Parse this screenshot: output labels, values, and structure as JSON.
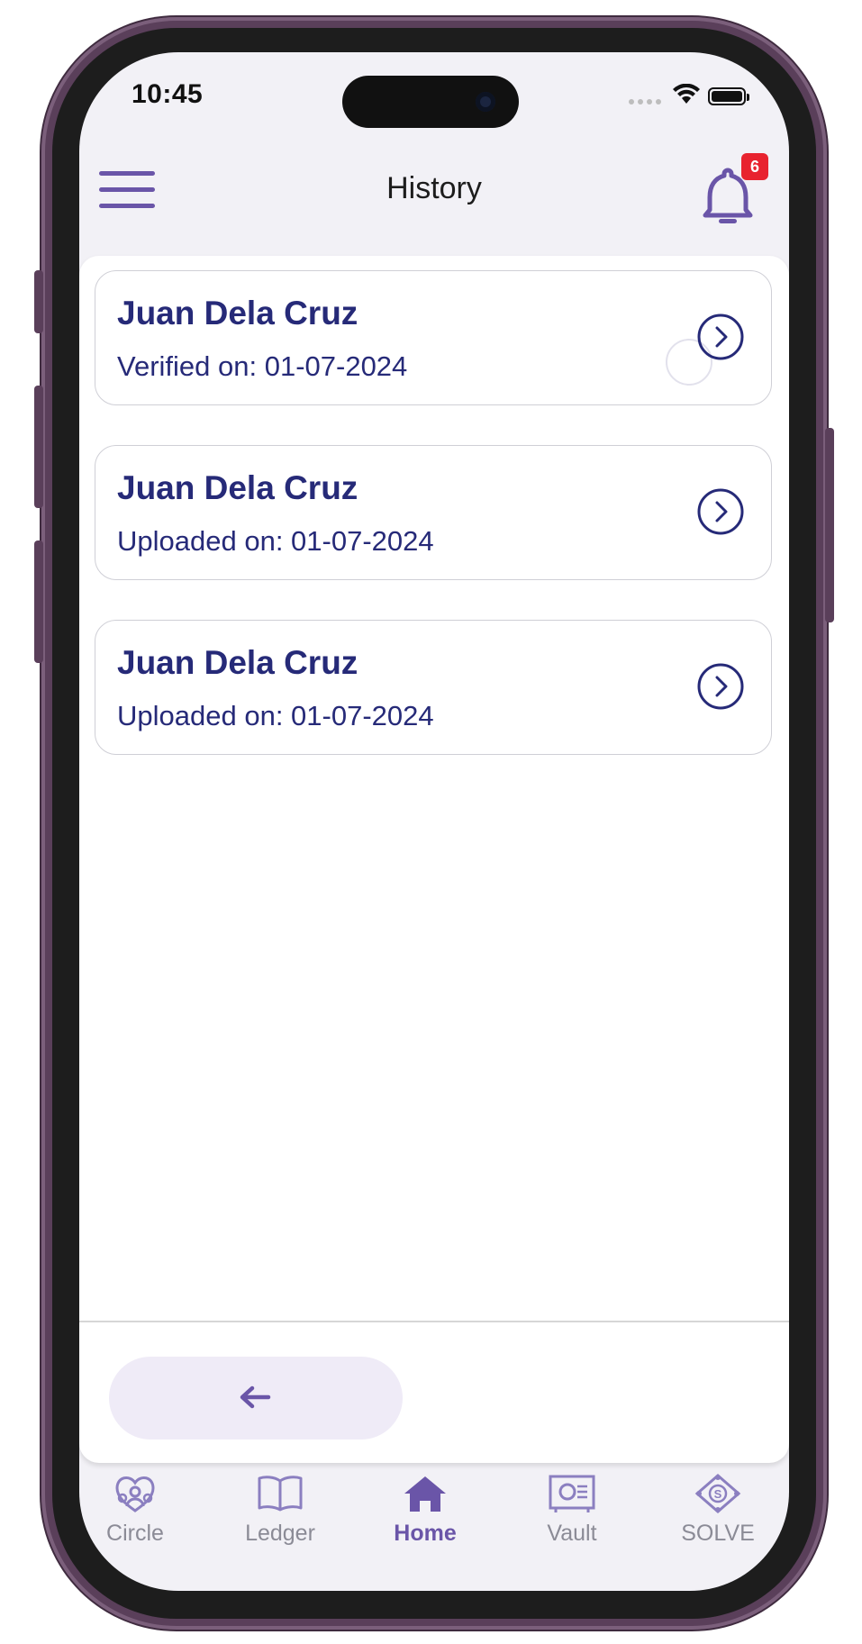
{
  "status_bar": {
    "time": "10:45"
  },
  "header": {
    "title": "History",
    "notification_count": "6"
  },
  "history_items": [
    {
      "name": "Juan Dela Cruz",
      "status": "Verified on: 01-07-2024"
    },
    {
      "name": "Juan Dela Cruz",
      "status": "Uploaded on: 01-07-2024"
    },
    {
      "name": "Juan Dela Cruz",
      "status": "Uploaded on: 01-07-2024"
    }
  ],
  "bottom_nav": {
    "active": "Home",
    "tabs": [
      {
        "label": "Circle",
        "icon": "circle-people-icon"
      },
      {
        "label": "Ledger",
        "icon": "book-icon"
      },
      {
        "label": "Home",
        "icon": "home-icon"
      },
      {
        "label": "Vault",
        "icon": "vault-icon"
      },
      {
        "label": "SOLVE",
        "icon": "solve-icon"
      }
    ]
  },
  "colors": {
    "accent": "#6a55a8",
    "text_dark_blue": "#262a78",
    "badge": "#e8232f",
    "back_button_bg": "#efebf7"
  }
}
